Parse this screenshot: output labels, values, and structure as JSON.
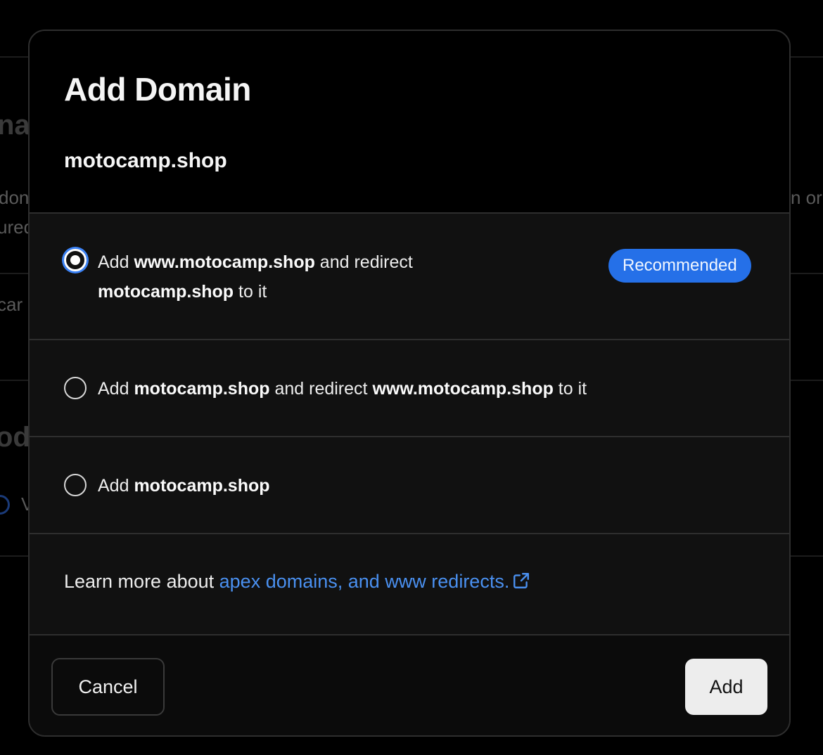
{
  "background": {
    "title_fragment_1": "na",
    "text_fragment_1": "don",
    "text_fragment_2": "ured",
    "text_fragment_3": "n or",
    "text_fragment_4": "car",
    "title_fragment_2": "od",
    "text_fragment_5": "V"
  },
  "modal": {
    "title": "Add Domain",
    "domain": "motocamp.shop",
    "options": [
      {
        "selected": true,
        "parts": [
          "Add ",
          "www.motocamp.shop",
          " and redirect ",
          "motocamp.shop",
          " to it"
        ],
        "badge": "Recommended"
      },
      {
        "selected": false,
        "parts": [
          "Add ",
          "motocamp.shop",
          " and redirect ",
          "www.motocamp.shop",
          " to it"
        ]
      },
      {
        "selected": false,
        "parts": [
          "Add ",
          "motocamp.shop"
        ]
      }
    ],
    "learn_more": {
      "prefix": "Learn more about ",
      "link_text": "apex domains, and www redirects.",
      "icon": "external-link-icon"
    },
    "footer": {
      "cancel_label": "Cancel",
      "add_label": "Add"
    }
  },
  "colors": {
    "accent": "#2570e8",
    "link": "#4a90f0",
    "modal_bg": "#111111",
    "header_bg": "#000000"
  }
}
